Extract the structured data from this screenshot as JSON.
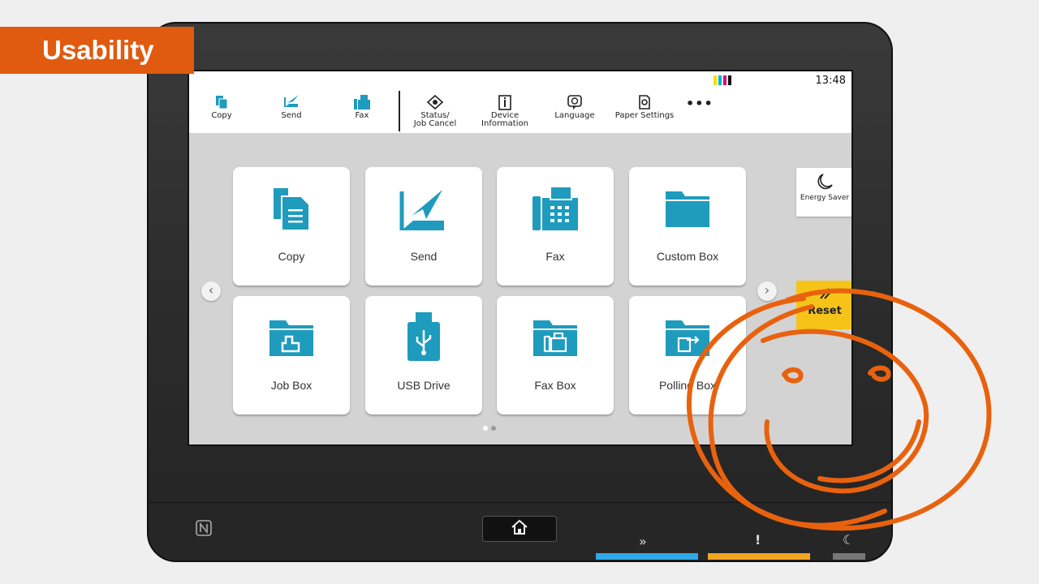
{
  "banner": {
    "label": "Usability"
  },
  "status": {
    "clock": "13:48",
    "toner_colors": [
      "#f2e200",
      "#00aee0",
      "#e0007a",
      "#111111"
    ]
  },
  "topbar": {
    "items": [
      {
        "label": "Copy",
        "icon": "copy-icon"
      },
      {
        "label": "Send",
        "icon": "send-icon"
      },
      {
        "label": "Fax",
        "icon": "fax-icon"
      },
      {
        "label": "Status/\nJob Cancel",
        "icon": "eye-icon"
      },
      {
        "label": "Device\nInformation",
        "icon": "device-info-icon"
      },
      {
        "label": "Language",
        "icon": "language-icon"
      },
      {
        "label": "Paper Settings",
        "icon": "paper-settings-icon"
      }
    ],
    "more_label": "•••"
  },
  "tiles": [
    {
      "label": "Copy",
      "icon": "copy-icon"
    },
    {
      "label": "Send",
      "icon": "send-icon"
    },
    {
      "label": "Fax",
      "icon": "fax-icon"
    },
    {
      "label": "Custom Box",
      "icon": "folder-icon"
    },
    {
      "label": "Job Box",
      "icon": "job-box-icon"
    },
    {
      "label": "USB Drive",
      "icon": "usb-drive-icon"
    },
    {
      "label": "Fax Box",
      "icon": "fax-box-icon"
    },
    {
      "label": "Polling Box",
      "icon": "polling-box-icon"
    }
  ],
  "side": {
    "energy_saver": "Energy Saver",
    "reset": "Reset"
  },
  "nav": {
    "prev": "‹",
    "next": "›"
  },
  "colors": {
    "accent_teal": "#1e9bbd",
    "reset_yellow": "#f6c418",
    "banner_orange": "#e05a10",
    "swirl_orange": "#e8620e"
  }
}
